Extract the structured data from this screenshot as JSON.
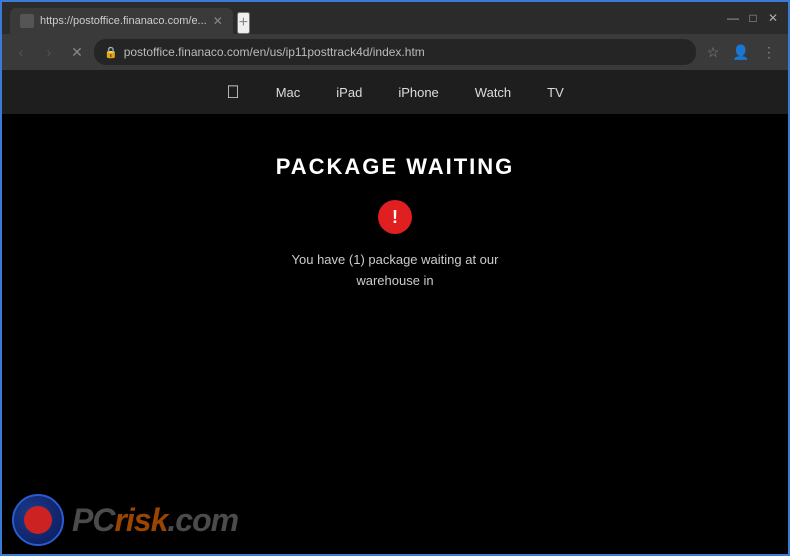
{
  "browser": {
    "tab": {
      "title": "https://postoffice.finanaco.com/e...",
      "favicon": "page-favicon"
    },
    "new_tab_label": "+",
    "window_controls": {
      "minimize": "—",
      "maximize": "□",
      "close": "✕"
    },
    "nav": {
      "back_label": "‹",
      "forward_label": "›",
      "reload_label": "✕",
      "url": "postoffice.finanaco.com/en/us/ip11posttrack4d/index.htm",
      "lock_icon": "🔒",
      "star_label": "☆",
      "profile_label": "👤",
      "menu_label": "⋮"
    }
  },
  "apple_nav": {
    "logo": "",
    "items": [
      {
        "label": "Mac"
      },
      {
        "label": "iPad"
      },
      {
        "label": "iPhone"
      },
      {
        "label": "Watch"
      },
      {
        "label": "TV"
      }
    ]
  },
  "page": {
    "title": "PACKAGE WAITING",
    "alert_symbol": "!",
    "message_line1": "You have (1) package waiting at our",
    "message_line2": "warehouse in"
  },
  "watermark": {
    "text_pc": "PC",
    "text_risk": "risk",
    "text_com": ".com"
  }
}
